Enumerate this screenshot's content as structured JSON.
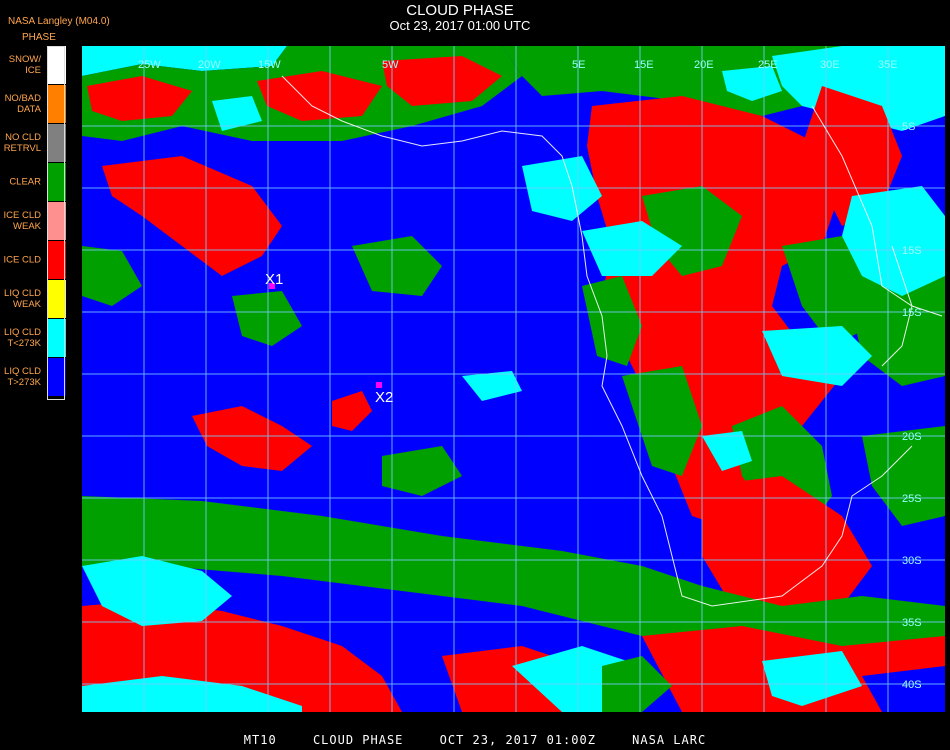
{
  "header": {
    "title": "CLOUD PHASE",
    "subtitle": "Oct 23, 2017 01:00 UTC",
    "producer": "NASA Langley (M04.0)",
    "legend_title": "PHASE"
  },
  "legend": [
    {
      "label": "SNOW/\nICE",
      "color": "#ffffff"
    },
    {
      "label": "NO/BAD\nDATA",
      "color": "#ff7f00"
    },
    {
      "label": "NO CLD\nRETRVL",
      "color": "#808080"
    },
    {
      "label": "CLEAR",
      "color": "#00a000"
    },
    {
      "label": "ICE CLD\nWEAK",
      "color": "#ff9090"
    },
    {
      "label": "ICE CLD",
      "color": "#ff0000"
    },
    {
      "label": "LIQ CLD\nWEAK",
      "color": "#ffff00"
    },
    {
      "label": "LIQ CLD\nT<273K",
      "color": "#00ffff"
    },
    {
      "label": "LIQ CLD\nT>273K",
      "color": "#0000ff"
    }
  ],
  "map": {
    "lon_labels": [
      "25W",
      "20W",
      "15W",
      "5W",
      "5E",
      "15E",
      "20E",
      "25E",
      "30E",
      "35E"
    ],
    "lat_labels": [
      "5S",
      "15S",
      "15S",
      "20S",
      "25S",
      "30S",
      "35S",
      "40S"
    ],
    "markers": [
      {
        "label": "X1",
        "color": "#ff00ff"
      },
      {
        "label": "X2",
        "color": "#ff00ff"
      }
    ]
  },
  "footer": {
    "satellite": "MT10",
    "product": "CLOUD PHASE",
    "datetime": "OCT 23, 2017 01:00Z",
    "source": "NASA LARC"
  }
}
